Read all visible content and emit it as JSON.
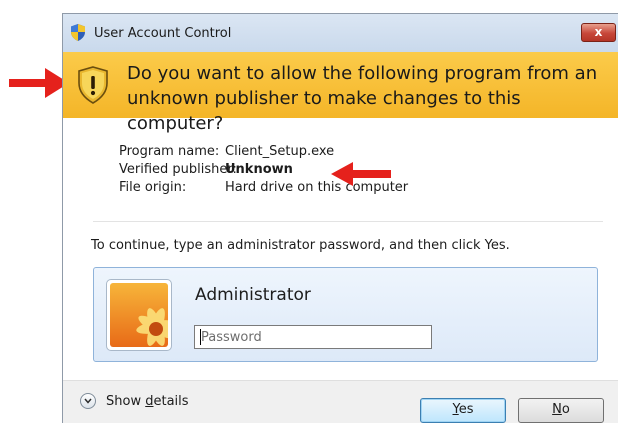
{
  "window": {
    "title": "User Account Control",
    "close_label": "x"
  },
  "banner": {
    "question": "Do you want to allow the following program from an unknown publisher to make changes to this computer?"
  },
  "program_info": {
    "rows": [
      {
        "label": "Program name:",
        "value": "Client_Setup.exe"
      },
      {
        "label": "Verified publisher:",
        "value": "Unknown"
      },
      {
        "label": "File origin:",
        "value": "Hard drive on this computer"
      }
    ]
  },
  "instructions": "To continue, type an administrator password, and then click Yes.",
  "credentials": {
    "username": "Administrator",
    "password_placeholder": "Password"
  },
  "footer": {
    "details_prefix": "Show ",
    "details_mnemonic": "d",
    "details_suffix": "etails",
    "yes_mnemonic": "Y",
    "yes_suffix": "es",
    "no_mnemonic": "N",
    "no_suffix": "o"
  },
  "colors": {
    "banner": "#f6bc2f",
    "arrow": "#e5211c",
    "close_button": "#c7473a",
    "focused_button_border": "#3c7fb1"
  },
  "icons": {
    "title": "uac-shield-icon",
    "banner": "warning-shield-icon",
    "avatar": "flower-avatar",
    "details": "chevron-down-icon",
    "arrows": "red-arrow-icon"
  }
}
